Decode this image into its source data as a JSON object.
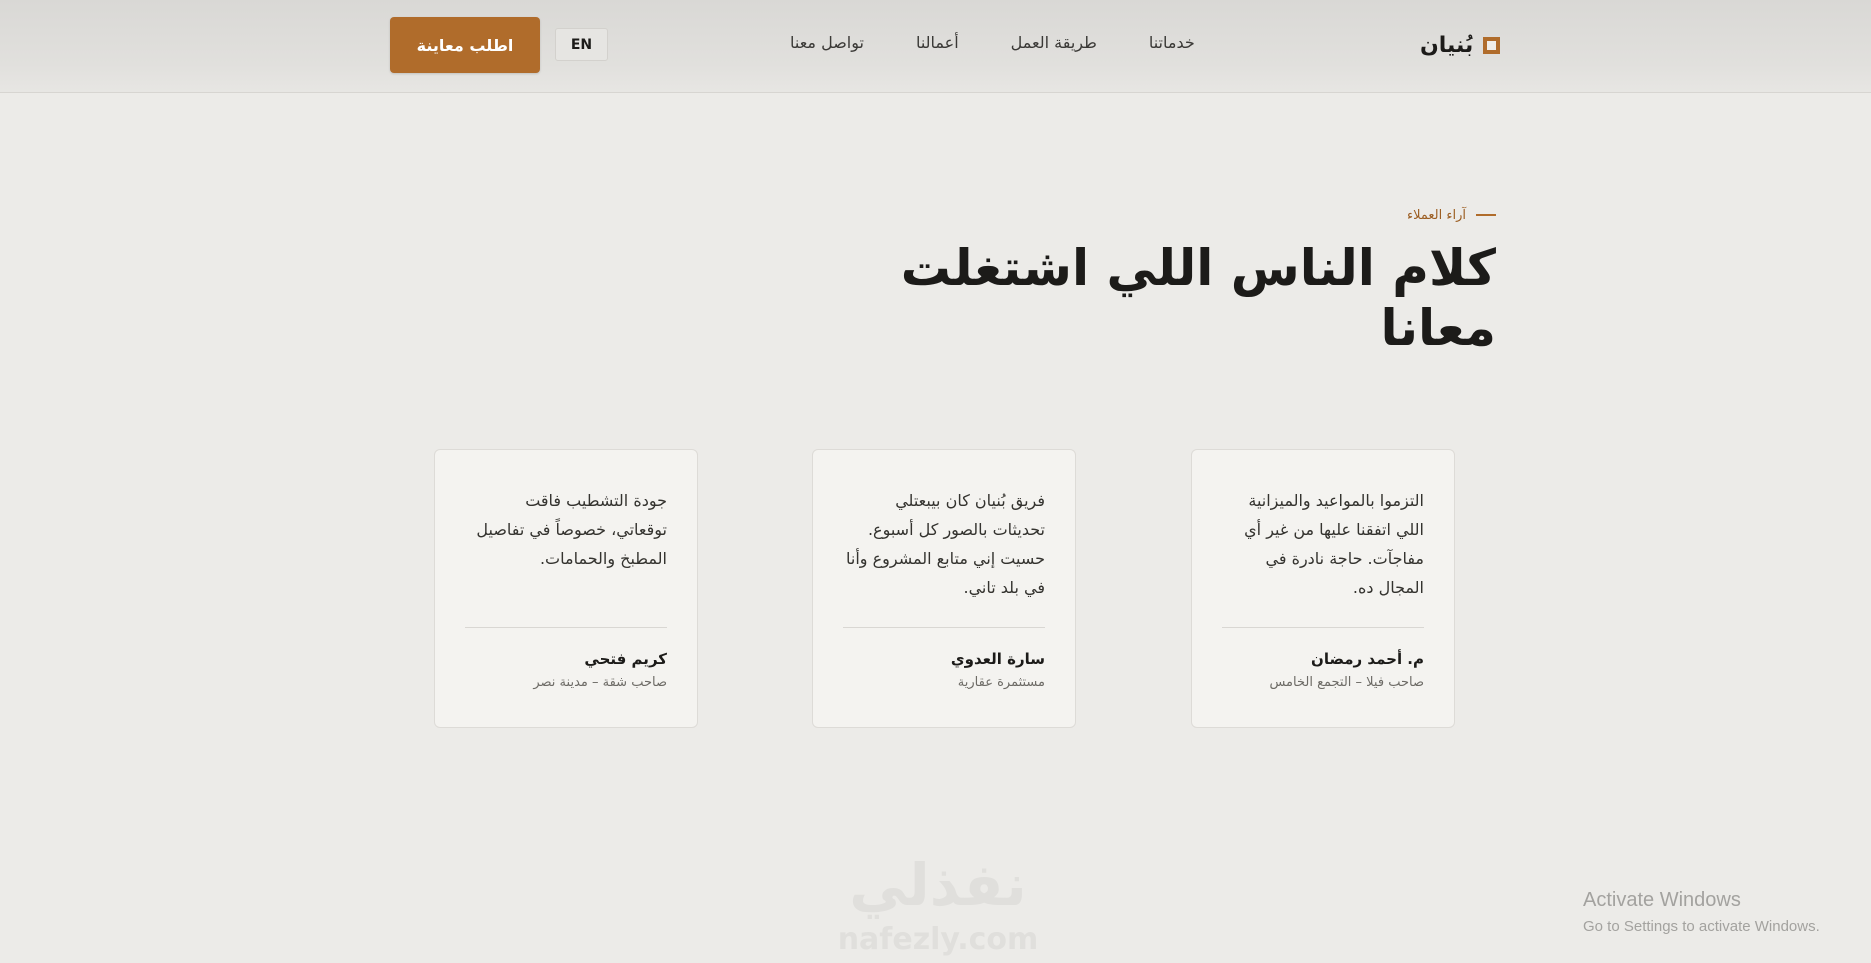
{
  "nav": {
    "brand_name": "بُنيان",
    "links": [
      "خدماتنا",
      "طريقة العمل",
      "أعمالنا",
      "تواصل معنا"
    ],
    "lang_label": "EN",
    "cta_label": "اطلب معاينة"
  },
  "testimonials": {
    "eyebrow": "آراء العملاء",
    "title": "كلام الناس اللي اشتغلت معانا",
    "cards": [
      {
        "quote": "التزموا بالمواعيد والميزانية اللي اتفقنا عليها من غير أي مفاجآت. حاجة نادرة في المجال ده.",
        "name": "م. أحمد رمضان",
        "role": "صاحب فيلا – التجمع الخامس"
      },
      {
        "quote": "فريق بُنيان كان بيبعتلي تحديثات بالصور كل أسبوع. حسيت إني متابع المشروع وأنا في بلد تاني.",
        "name": "سارة العدوي",
        "role": "مستثمرة عقارية"
      },
      {
        "quote": "جودة التشطيب فاقت توقعاتي، خصوصاً في تفاصيل المطبخ والحمامات.",
        "name": "كريم فتحي",
        "role": "صاحب شقة – مدينة نصر"
      }
    ]
  },
  "watermark": {
    "arabic": "نفذلي",
    "latin": "nafezly.com"
  },
  "windows_notice": {
    "title": "Activate Windows",
    "subtitle": "Go to Settings to activate Windows."
  },
  "colors": {
    "accent": "#b06c2b",
    "background": "#ecebe8",
    "card_background": "#f4f3f0"
  }
}
